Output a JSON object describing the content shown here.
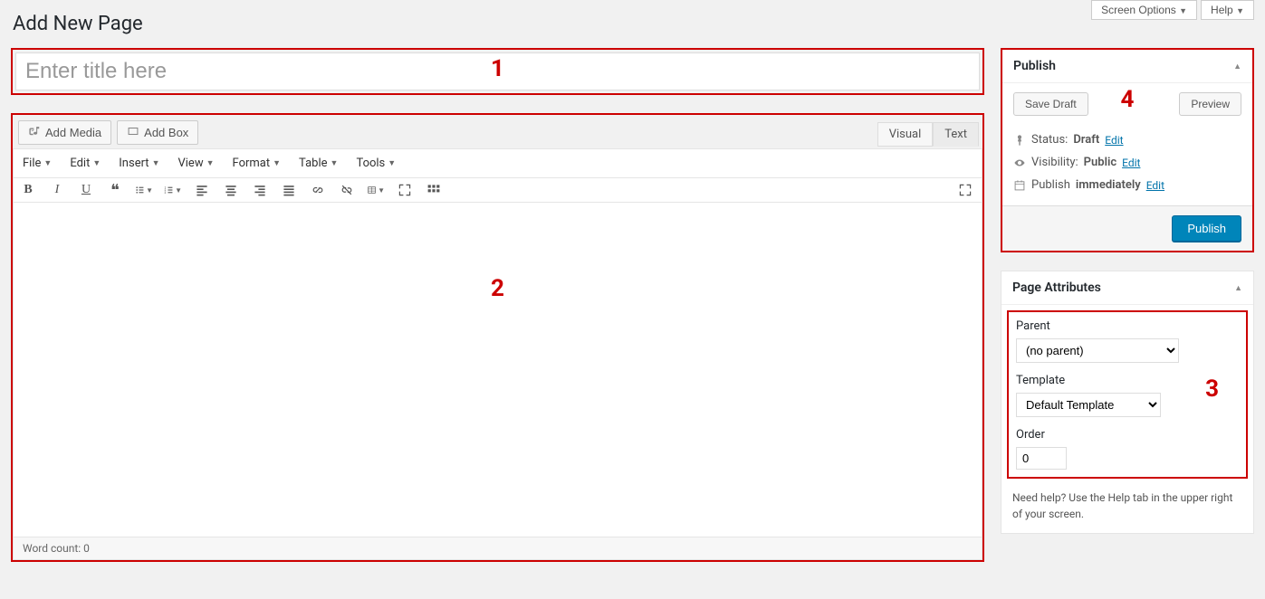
{
  "top": {
    "screen_options": "Screen Options",
    "help": "Help"
  },
  "page_title": "Add New Page",
  "title_placeholder": "Enter title here",
  "media": {
    "add_media": "Add Media",
    "add_box": "Add Box"
  },
  "tabs": {
    "visual": "Visual",
    "text": "Text"
  },
  "menus": [
    "File",
    "Edit",
    "Insert",
    "View",
    "Format",
    "Table",
    "Tools"
  ],
  "status_bar": "Word count: 0",
  "publish": {
    "heading": "Publish",
    "save_draft": "Save Draft",
    "preview": "Preview",
    "status_label": "Status:",
    "status_value": "Draft",
    "visibility_label": "Visibility:",
    "visibility_value": "Public",
    "schedule_label": "Publish",
    "schedule_value": "immediately",
    "edit": "Edit",
    "publish_btn": "Publish"
  },
  "attributes": {
    "heading": "Page Attributes",
    "parent_label": "Parent",
    "parent_value": "(no parent)",
    "template_label": "Template",
    "template_value": "Default Template",
    "order_label": "Order",
    "order_value": "0",
    "help": "Need help? Use the Help tab in the upper right of your screen."
  },
  "annotations": {
    "a1": "1",
    "a2": "2",
    "a3": "3",
    "a4": "4"
  }
}
